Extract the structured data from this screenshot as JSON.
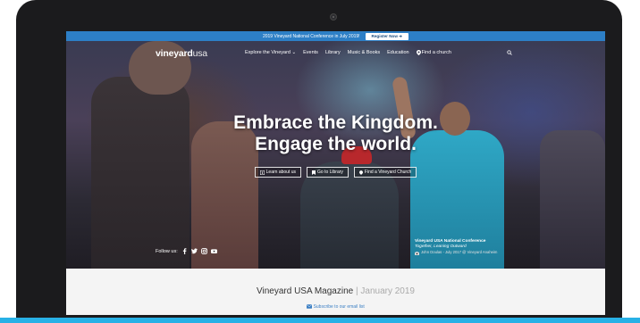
{
  "promo": {
    "text": "2019 Vineyard National Conference in July 2019!",
    "button": "Register Now ➜"
  },
  "nav": {
    "logo_main": "vineyard",
    "logo_suffix": "usa",
    "items": [
      "Explore the Vineyard ⌄",
      "Events",
      "Library",
      "Music & Books",
      "Education",
      "Find a church"
    ]
  },
  "hero": {
    "headline_1": "Embrace the Kingdom.",
    "headline_2": "Engage the world.",
    "buttons": [
      "Learn about us",
      "Go to Library",
      "Find a Vineyard Church"
    ],
    "follow_label": "Follow us:",
    "caption": {
      "title": "Vineyard USA National Conference",
      "subtitle": "Together, Leaning Outward",
      "credit": "John Doulas - July 2017 @ Vineyard Anaheim"
    }
  },
  "magazine": {
    "title": "Vineyard USA Magazine",
    "date": "January 2019",
    "subscribe": "Subscribe to our email list"
  },
  "colors": {
    "promo_bar": "#2d7fc6",
    "accent_blue": "#28b1e6",
    "link": "#3b7fc4"
  },
  "icons": [
    "search-icon",
    "facebook-icon",
    "twitter-icon",
    "instagram-icon",
    "youtube-icon",
    "pin-icon",
    "mail-icon",
    "camera-icon"
  ]
}
